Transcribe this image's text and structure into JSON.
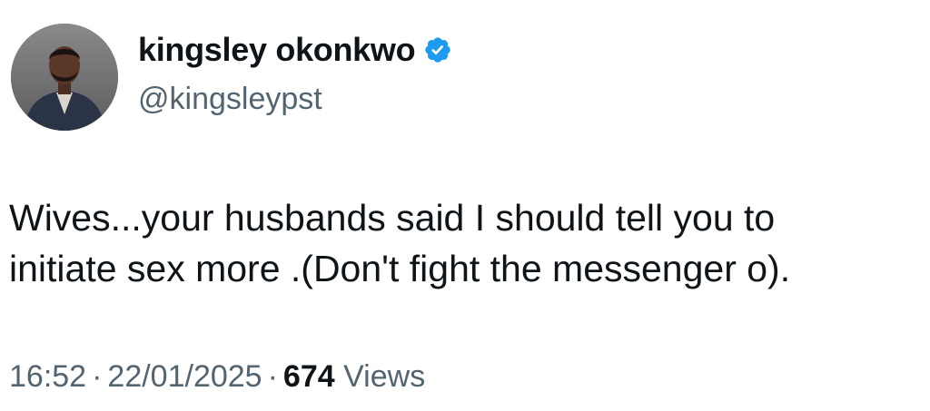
{
  "author": {
    "display_name": "kingsley okonkwo",
    "handle": "@kingsleypst",
    "verified_icon": "verified-badge-icon",
    "avatar_icon": "profile-photo"
  },
  "tweet": {
    "lines": [
      "Wives...your husbands said I should tell you to",
      "initiate sex more .(Don't fight the messenger o)."
    ]
  },
  "meta": {
    "time": "16:52",
    "separator": "·",
    "date": "22/01/2025",
    "views_count": "674",
    "views_label": "Views"
  },
  "colors": {
    "primary_text": "#0f1419",
    "secondary_text": "#536471",
    "verified_blue": "#1d9bf0"
  }
}
